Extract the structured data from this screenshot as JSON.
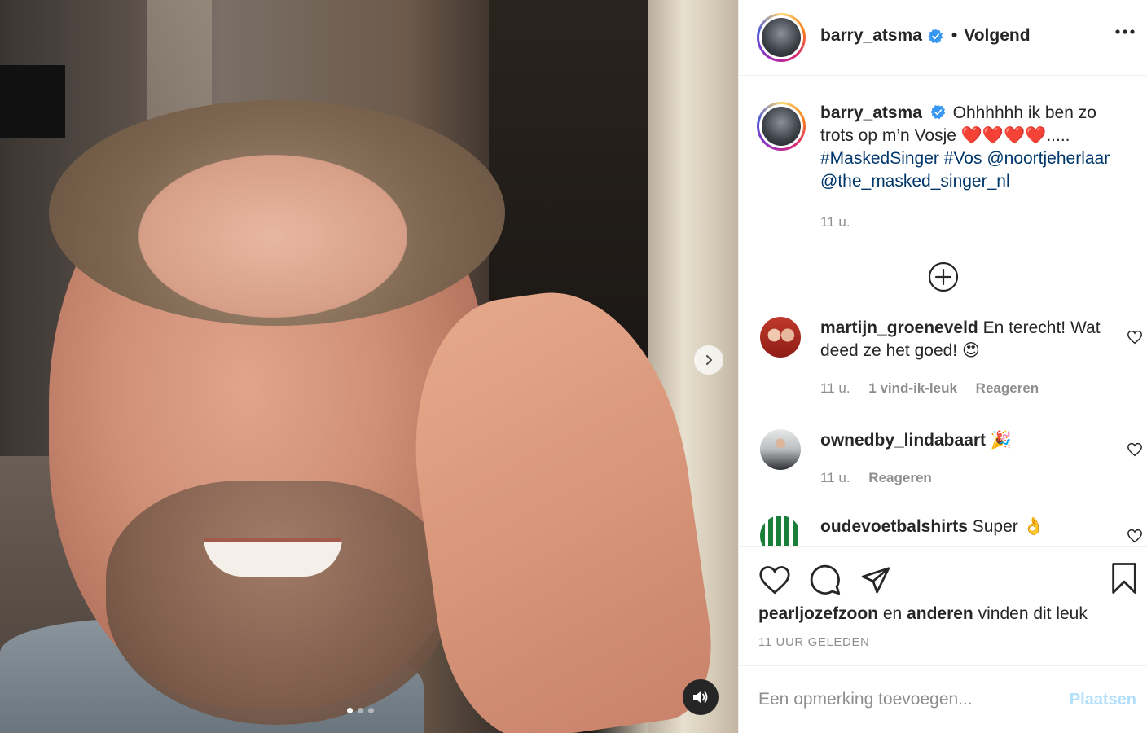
{
  "post": {
    "author": "barry_atsma",
    "follow_status": "Volgend",
    "separator": "•",
    "caption_text": "Ohhhhhh ik ben zo trots op m’n Vosje ❤️❤️❤️❤️.....",
    "hashtags": [
      "#MaskedSinger",
      "#Vos"
    ],
    "mentions": [
      "@noortjeherlaar",
      "@the_masked_singer_nl"
    ],
    "caption_time": "11 u."
  },
  "comments": [
    {
      "username": "martijn_groeneveld",
      "text": "En terecht! Wat deed ze het goed! 😍",
      "time": "11 u.",
      "likes": "1 vind-ik-leuk",
      "reply": "Reageren"
    },
    {
      "username": "ownedby_lindabaart",
      "text": "🎉",
      "time": "11 u.",
      "reply": "Reageren"
    },
    {
      "username": "oudevoetbalshirts",
      "text": "Super 👌"
    }
  ],
  "likes_line": {
    "user": "pearljozefzoon",
    "connector": "en",
    "others": "anderen",
    "suffix": "vinden dit leuk"
  },
  "posted_ago": "11 UUR GELEDEN",
  "comment_box": {
    "placeholder": "Een opmerking toevoegen...",
    "post_label": "Plaatsen"
  },
  "carousel": {
    "slides": 3,
    "active_index": 0
  },
  "colors": {
    "link": "#00376b",
    "verified": "#3897f0",
    "muted": "#8e8e8e",
    "post_disabled": "#b2dffc"
  }
}
